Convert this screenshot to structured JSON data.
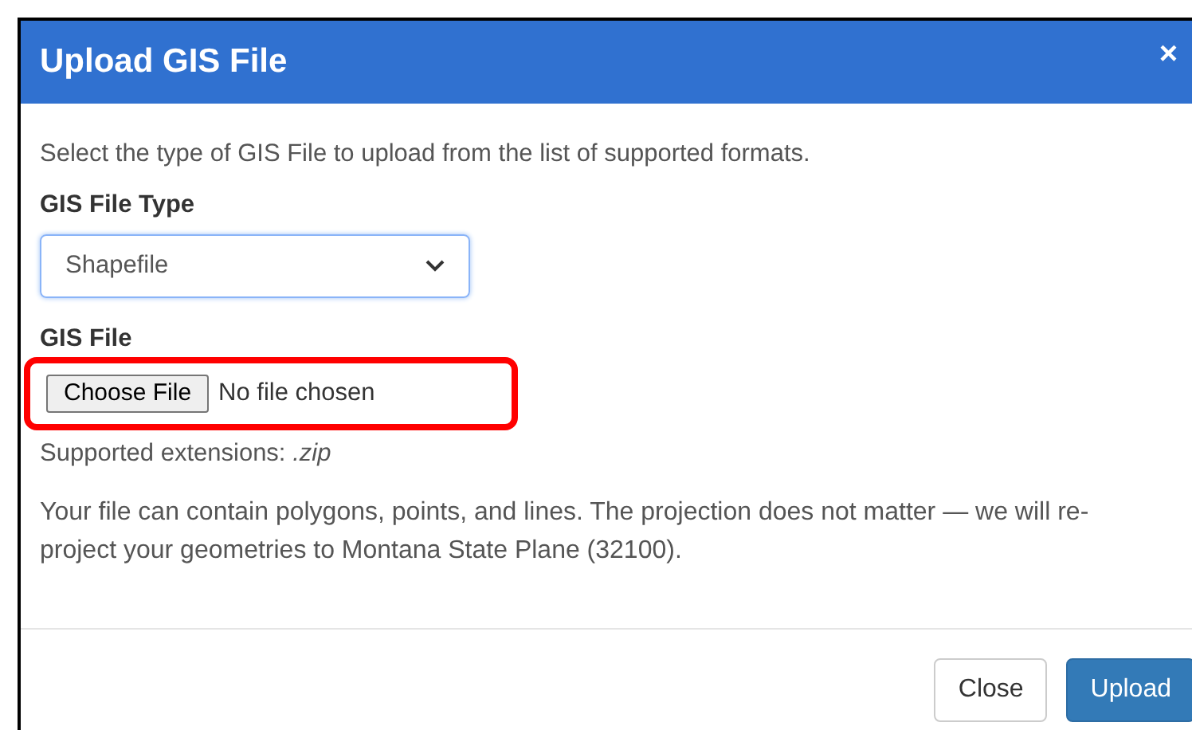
{
  "dialog": {
    "title": "Upload GIS File",
    "close_glyph": "×",
    "intro": "Select the type of GIS File to upload from the list of supported formats.",
    "file_type": {
      "label": "GIS File Type",
      "value": "Shapefile"
    },
    "file": {
      "label": "GIS File",
      "button": "Choose File",
      "status": "No file chosen",
      "highlighted": true
    },
    "extensions": "Supported extensions: *.zip*",
    "note": "Your file can contain polygons, points, and lines. The projection does not matter — we will re-project your geometries to Montana State Plane (32100).",
    "buttons": [
      {
        "label": "Close",
        "kind": "secondary"
      },
      {
        "label": "Upload",
        "kind": "primary"
      }
    ]
  }
}
